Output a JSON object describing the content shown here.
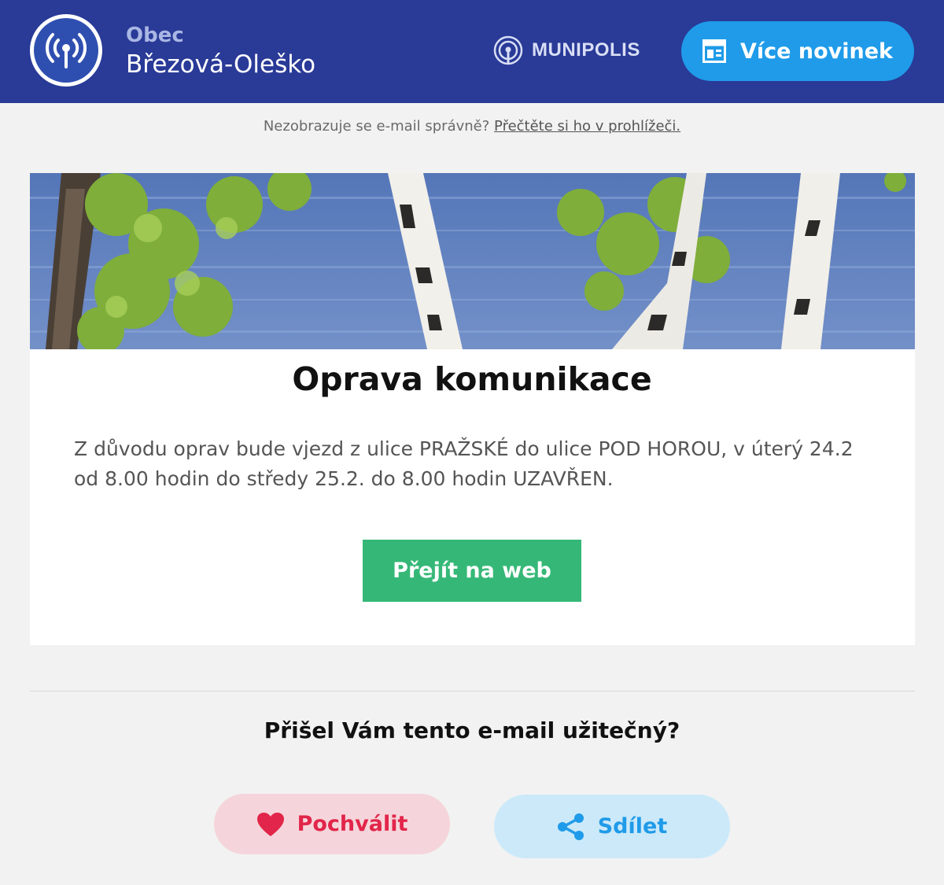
{
  "header": {
    "obec_label": "Obec",
    "obec_name": "Březová-Oleško",
    "brand": "MUNIPOLIS",
    "more_news_label": "Více novinek",
    "background_color": "#293a97",
    "accent_color": "#1f9be9"
  },
  "preheader": {
    "text": "Nezobrazuje se e-mail správně?",
    "link_label": "Přečtěte si ho v prohlížeči."
  },
  "article": {
    "title": "Oprava komunikace",
    "body": "Z důvodu oprav bude vjezd z ulice PRAŽSKÉ do ulice POD  HOROU, v úterý 24.2  od 8.00 hodin do středy  25.2. do 8.00 hodin  UZAVŘEN.",
    "button_label": "Přejít na web",
    "button_color": "#35b877"
  },
  "feedback": {
    "question": "Přišel Vám tento e-mail užitečný?",
    "praise_label": "Pochválit",
    "share_label": "Sdílet",
    "praise_color": "#e2254a",
    "share_color": "#1f9be9"
  },
  "icons": {
    "logo": "radio-broadcast-icon",
    "brand": "broadcast-icon",
    "more_news": "newspaper-icon",
    "praise": "heart-icon",
    "share": "share-icon"
  }
}
